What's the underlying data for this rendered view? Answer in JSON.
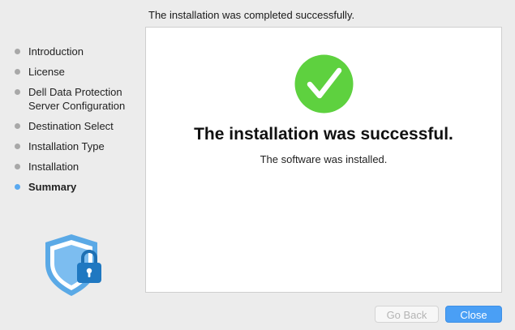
{
  "header": {
    "status_text": "The installation was completed successfully."
  },
  "sidebar": {
    "steps": [
      {
        "label": "Introduction"
      },
      {
        "label": "License"
      },
      {
        "label": "Dell Data Protection Server Configuration"
      },
      {
        "label": "Destination Select"
      },
      {
        "label": "Installation Type"
      },
      {
        "label": "Installation"
      },
      {
        "label": "Summary",
        "active": true
      }
    ],
    "logo_icon": "shield-lock-icon"
  },
  "main": {
    "success_icon": "check-circle-icon",
    "headline": "The installation was successful.",
    "subline": "The software was installed."
  },
  "footer": {
    "back_label": "Go Back",
    "close_label": "Close"
  },
  "colors": {
    "accent": "#4a9ff5",
    "success": "#5ed13f",
    "shield": "#5aa9e6"
  }
}
